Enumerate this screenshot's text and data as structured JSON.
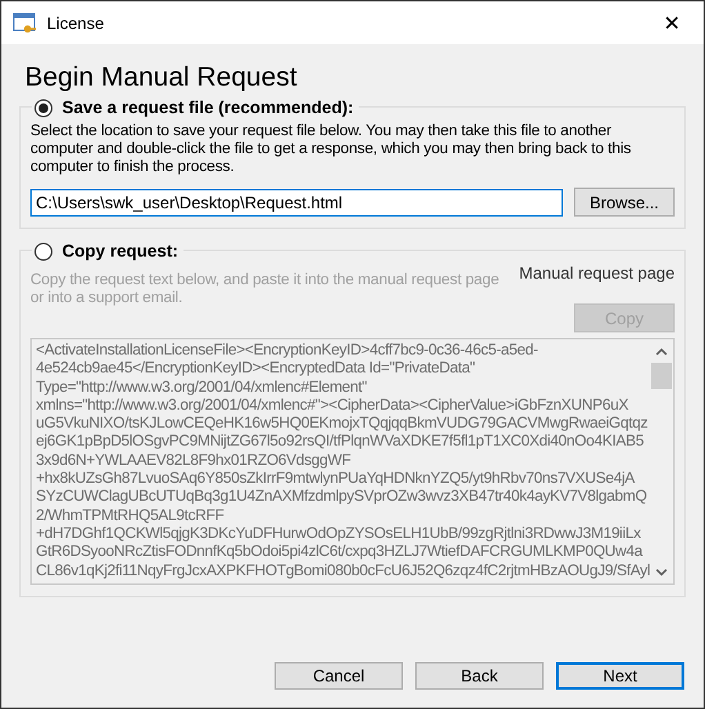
{
  "window": {
    "title": "License",
    "close": "✕"
  },
  "heading": "Begin Manual Request",
  "options": [
    {
      "kind": "save",
      "label": "Save a request file (recommended):",
      "selected": true,
      "description": "Select the location to save your request file below.  You may then take this file to another computer and double-click the file to get a response, which you may then bring back to this computer to finish the process.",
      "path": "C:\\Users\\swk_user\\Desktop\\Request.html",
      "button": "Browse..."
    },
    {
      "kind": "copy",
      "label": "Copy request:",
      "selected": false,
      "description": "Copy the request text below, and paste it into the manual request page or into a support email.",
      "link": "Manual request page",
      "button": "Copy",
      "disabled": true,
      "request_lines": [
        "<ActivateInstallationLicenseFile><EncryptionKeyID>4cff7bc9-0c36-46c5-a5ed-",
        "4e524cb9ae45</EncryptionKeyID><EncryptedData Id=\"PrivateData\"",
        "Type=\"http://www.w3.org/2001/04/xmlenc#Element\"",
        "xmlns=\"http://www.w3.org/2001/04/xmlenc#\"><CipherData><CipherValue>iGbFznXUNP6uX",
        "uG5VkuNIXO/tsKJLowCEQeHK16w5HQ0EKmojxTQqjqqBkmVUDG79GACVMwgRwaeiGqtqz",
        "ej6GK1pBpD5lOSgvPC9MNijtZG67l5o92rsQI/tfPlqnWVaXDKE7f5fl1pT1XC0Xdi40nOo4KIAB5",
        "3x9d6N+YWLAAEV82L8F9hx01RZO6VdsggWF",
        "+hx8kUZsGh87LvuoSAq6Y850sZkIrrF9mtwlynPUaYqHDNknYZQ5/yt9hRbv70ns7VXUSe4jA",
        "SYzCUWClagUBcUTUqBq3g1U4ZnAXMfzdmlpySVprOZw3wvz3XB47tr40k4ayKV7V8lgabmQ",
        "2/WhmTPMtRHQ5AL9tcRFF",
        "+dH7DGhf1QCKWl5qjgK3DKcYuDFHurwOdOpZYSOsELH1UbB/99zgRjtlni3RDwwJ3M19iiLx",
        "GtR6DSyooNRcZtisFODnnfKq5bOdoi5pi4zlC6t/cxpq3HZLJ7WtiefDAFCRGUMLKMP0QUw4a",
        "CL86v1qKj2fi11NqyFrgJcxAXPKFHOTgBomi080b0cFcU6J52Q6zqz4fC2rjtmHBzAOUgJ9/SfAyl"
      ]
    }
  ],
  "buttons": [
    {
      "label": "Cancel",
      "default": false
    },
    {
      "label": "Back",
      "default": false
    },
    {
      "label": "Next",
      "default": true
    }
  ]
}
